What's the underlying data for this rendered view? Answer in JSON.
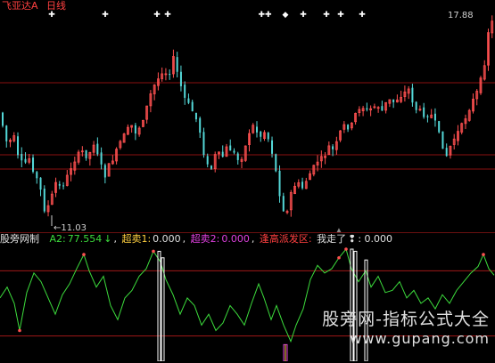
{
  "colors": {
    "up": "#ff5050",
    "down": "#54d8d8",
    "grid": "#8a1010",
    "ind_line": "#3cdc3c",
    "ind_ref": "#a01818",
    "spike_white": "#ffffff",
    "spike_magenta": "#e040e0",
    "marker": "#ffffff"
  },
  "header": {
    "stock_name": "飞亚达A",
    "period": "日线"
  },
  "price_labels": {
    "high": "17.88",
    "low": "11.03"
  },
  "indicator_bar": {
    "name": "股旁网制",
    "a2_label": "A2:",
    "a2_value": "77.554",
    "a2_arrow": "↓",
    "chao_mai1_label": "超卖1:",
    "chao_mai1_value": "0.000",
    "chao_mai2_label": "超卖2:",
    "chao_mai2_value": "0.000",
    "feng_gao_label": "逢高派发区:",
    "zou_label": "我走了",
    "zou_value": ": 0.000"
  },
  "watermark": {
    "line1": "股旁网-指标公式大全",
    "line2": "www.gupang.com"
  },
  "chart_data": {
    "type": "candlestick",
    "price_high": 17.88,
    "price_low": 11.03,
    "candle_seed": 7,
    "candle_count": 130,
    "indicator_ref_levels": [
      80,
      20
    ],
    "marker_glyphs": [
      "✚",
      "✚",
      "✚",
      "✚",
      "✚✚",
      "◆",
      "✚",
      "✚",
      "✚",
      "✚"
    ]
  }
}
